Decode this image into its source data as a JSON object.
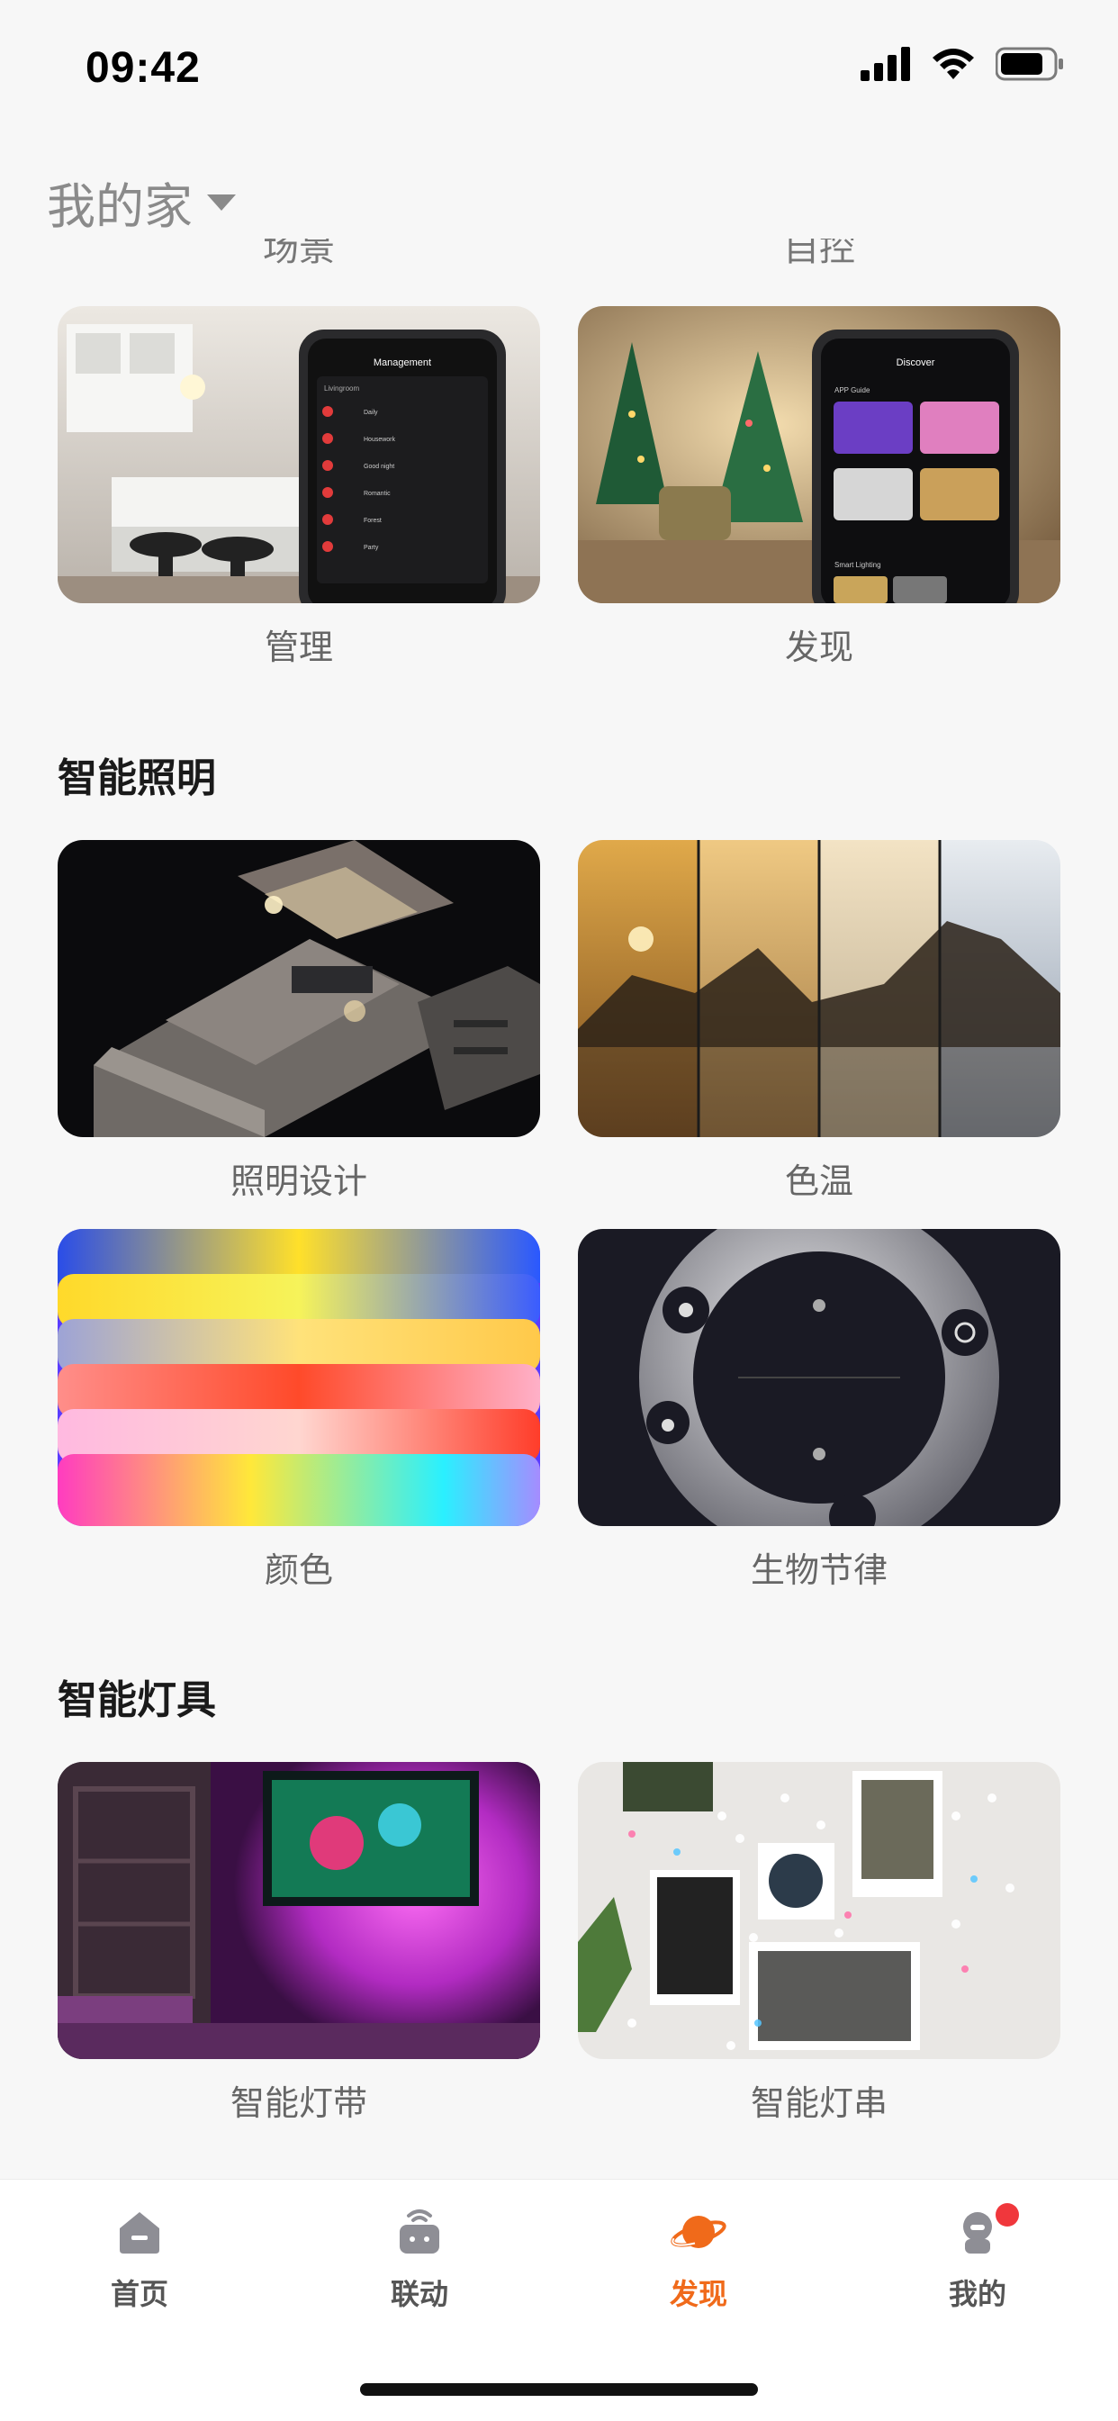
{
  "status_bar": {
    "time": "09:42"
  },
  "header": {
    "home_title": "我的家"
  },
  "top_clipped": {
    "left_label": "场景",
    "right_label": "自控"
  },
  "top_row": [
    {
      "label": "管理",
      "phone_title": "Management",
      "items": [
        "Daily",
        "Housework",
        "Good night",
        "Romantic",
        "Forest",
        "Party"
      ]
    },
    {
      "label": "发现",
      "phone_title": "Discover",
      "subtitle": "APP Guide",
      "footer": "Smart Lighting"
    }
  ],
  "sections": [
    {
      "title": "智能照明",
      "cards": [
        "照明设计",
        "色温",
        "颜色",
        "生物节律"
      ]
    },
    {
      "title": "智能灯具",
      "cards": [
        "智能灯带",
        "智能灯串"
      ]
    }
  ],
  "tabbar": {
    "items": [
      {
        "label": "首页",
        "icon": "home-icon"
      },
      {
        "label": "联动",
        "icon": "linkage-icon"
      },
      {
        "label": "发现",
        "icon": "planet-icon",
        "active": true
      },
      {
        "label": "我的",
        "icon": "profile-icon",
        "badge": true
      }
    ],
    "active_color": "#f06a1a"
  }
}
